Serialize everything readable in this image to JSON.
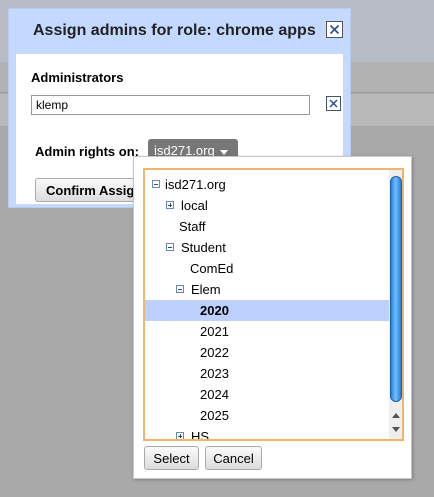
{
  "dialog": {
    "title": "Assign admins for role: chrome apps",
    "administrators_label": "Administrators",
    "admin_input_value": "klemp",
    "admin_rights_label": "Admin rights on:",
    "org_select_value": "isd271.org",
    "confirm_button": "Confirm Assign",
    "close_icon": "close-icon",
    "clear_icon": "clear-icon"
  },
  "tree": {
    "items": [
      {
        "label": "isd271.org",
        "state": "expanded"
      },
      {
        "label": "local",
        "state": "collapsed"
      },
      {
        "label": "Staff",
        "state": "leaf"
      },
      {
        "label": "Student",
        "state": "expanded"
      },
      {
        "label": "ComEd",
        "state": "leaf"
      },
      {
        "label": "Elem",
        "state": "expanded"
      },
      {
        "label": "2020",
        "state": "leaf",
        "selected": true
      },
      {
        "label": "2021",
        "state": "leaf"
      },
      {
        "label": "2022",
        "state": "leaf"
      },
      {
        "label": "2023",
        "state": "leaf"
      },
      {
        "label": "2024",
        "state": "leaf"
      },
      {
        "label": "2025",
        "state": "leaf"
      },
      {
        "label": "HS",
        "state": "collapsed"
      }
    ],
    "select_button": "Select",
    "cancel_button": "Cancel"
  },
  "colors": {
    "dialog_frame": "#c3d9ff",
    "selected_row": "#bcd0fb",
    "tree_border": "#f3b36a",
    "scroll_thumb": "#3b95e8"
  }
}
